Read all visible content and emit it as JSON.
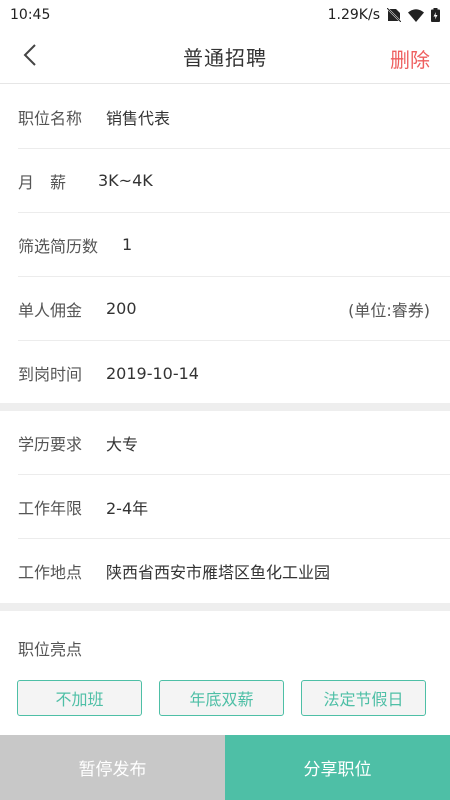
{
  "status_bar": {
    "time": "10:45",
    "network_speed": "1.29K/s",
    "icons": [
      "no-sim-icon",
      "wifi-icon",
      "battery-icon"
    ]
  },
  "nav": {
    "title": "普通招聘",
    "delete_label": "删除",
    "back_icon": "chevron-left-icon"
  },
  "fields": {
    "job_name": {
      "label": "职位名称",
      "value": "销售代表"
    },
    "salary": {
      "label": "月　薪",
      "value": "3K~4K"
    },
    "resume_count": {
      "label": "筛选简历数",
      "value": "1"
    },
    "commission": {
      "label": "单人佣金",
      "value": "200",
      "unit": "(单位:睿券)"
    },
    "arrival_time": {
      "label": "到岗时间",
      "value": "2019-10-14"
    },
    "education": {
      "label": "学历要求",
      "value": "大专"
    },
    "experience": {
      "label": "工作年限",
      "value": "2-4年"
    },
    "location": {
      "label": "工作地点",
      "value": "陕西省西安市雁塔区鱼化工业园"
    }
  },
  "highlights": {
    "title": "职位亮点",
    "tags": [
      "不加班",
      "年底双薪",
      "法定节假日"
    ]
  },
  "bottom": {
    "pause_label": "暂停发布",
    "share_label": "分享职位"
  },
  "colors": {
    "accent": "#4ebfa6",
    "delete": "#ee5e5e",
    "disabled": "#c8c8c8"
  }
}
